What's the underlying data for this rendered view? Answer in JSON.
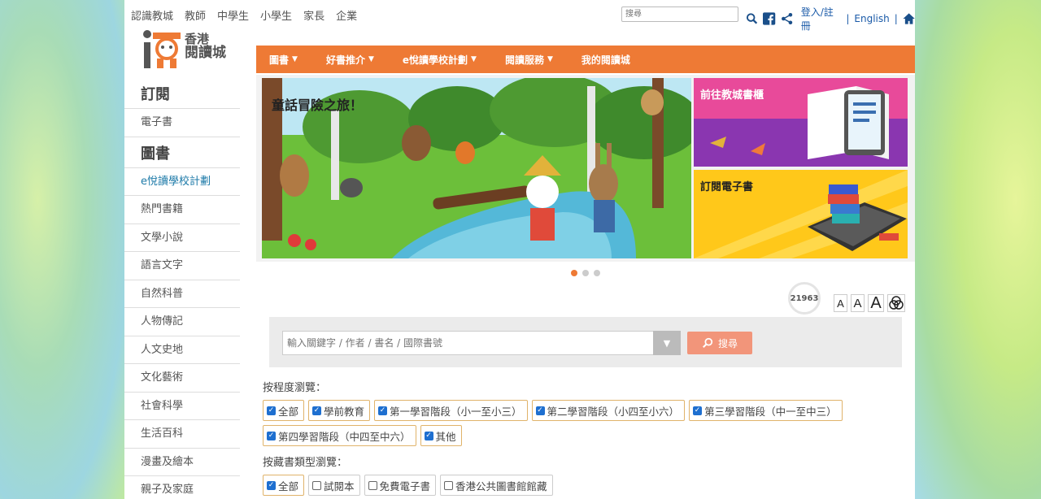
{
  "topnav": [
    "認識教城",
    "教師",
    "中學生",
    "小學生",
    "家長",
    "企業"
  ],
  "search": {
    "placeholder": "搜尋"
  },
  "account": {
    "login": "登入/註冊",
    "sep1": "|",
    "english": "English",
    "sep2": "|"
  },
  "logo": {
    "line1": "香港",
    "line2": "閱讀城"
  },
  "sidebar": {
    "subscribe": "訂閱",
    "ebook": "電子書",
    "books": "圖書",
    "items": [
      "e悅讀學校計劃",
      "熱門書籍",
      "文學小說",
      "語言文字",
      "自然科普",
      "人物傳記",
      "人文史地",
      "文化藝術",
      "社會科學",
      "生活百科",
      "漫畫及繪本",
      "親子及家庭"
    ]
  },
  "mainnav": [
    "圖書",
    "好書推介",
    "e悅讀學校計劃",
    "閱讀服務",
    "我的閱讀城"
  ],
  "banner": {
    "main_title": "童話冒險之旅！",
    "side1_title": "前往教城書櫃",
    "side2_title": "訂閱電子書"
  },
  "counter": "21963",
  "fontsize": [
    "A",
    "A",
    "A"
  ],
  "searchbar": {
    "placeholder": "輸入關鍵字 / 作者 / 書名 / 國際書號",
    "button": "搜尋"
  },
  "filters": {
    "level_label": "按程度瀏覽：",
    "levels": [
      "全部",
      "學前教育",
      "第一學習階段（小一至小三）",
      "第二學習階段（小四至小六）",
      "第三學習階段（中一至中三）",
      "第四學習階段（中四至中六）",
      "其他"
    ],
    "type_label": "按藏書類型瀏覽：",
    "types": [
      "全部",
      "試閱本",
      "免費電子書",
      "香港公共圖書館館藏"
    ]
  },
  "colors": {
    "accent": "#ee7a35",
    "link": "#1a5aa8",
    "active_side": "#1d7aa8"
  }
}
